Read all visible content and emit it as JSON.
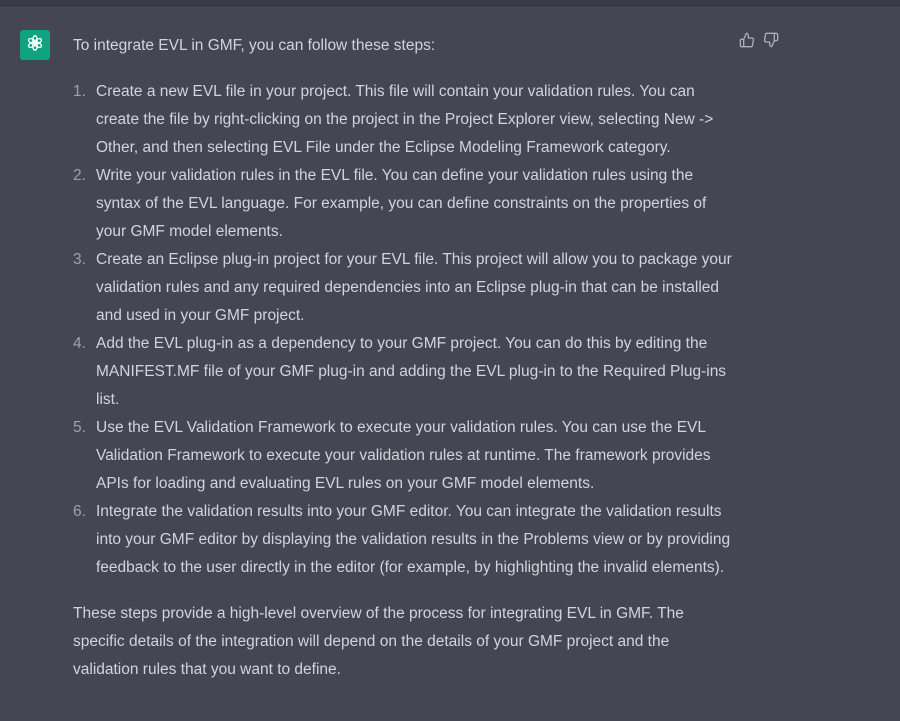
{
  "message": {
    "intro": "To integrate EVL in GMF, you can follow these steps:",
    "steps": [
      {
        "num": "1.",
        "text": "Create a new EVL file in your project. This file will contain your validation rules. You can create the file by right-clicking on the project in the Project Explorer view, selecting New -> Other, and then selecting EVL File under the Eclipse Modeling Framework category."
      },
      {
        "num": "2.",
        "text": "Write your validation rules in the EVL file. You can define your validation rules using the syntax of the EVL language. For example, you can define constraints on the properties of your GMF model elements."
      },
      {
        "num": "3.",
        "text": "Create an Eclipse plug-in project for your EVL file. This project will allow you to package your validation rules and any required dependencies into an Eclipse plug-in that can be installed and used in your GMF project."
      },
      {
        "num": "4.",
        "text": "Add the EVL plug-in as a dependency to your GMF project. You can do this by editing the MANIFEST.MF file of your GMF plug-in and adding the EVL plug-in to the Required Plug-ins list."
      },
      {
        "num": "5.",
        "text": "Use the EVL Validation Framework to execute your validation rules. You can use the EVL Validation Framework to execute your validation rules at runtime. The framework provides APIs for loading and evaluating EVL rules on your GMF model elements."
      },
      {
        "num": "6.",
        "text": "Integrate the validation results into your GMF editor. You can integrate the validation results into your GMF editor by displaying the validation results in the Problems view or by providing feedback to the user directly in the editor (for example, by highlighting the invalid elements)."
      }
    ],
    "outro": "These steps provide a high-level overview of the process for integrating EVL in GMF. The specific details of the integration will depend on the details of your GMF project and the validation rules that you want to define."
  },
  "icons": {
    "avatar": "openai-logo-icon",
    "thumbs_up": "thumbs-up-icon",
    "thumbs_down": "thumbs-down-icon"
  },
  "colors": {
    "background": "#444654",
    "avatar": "#10a37f",
    "text": "#d1d5db"
  }
}
